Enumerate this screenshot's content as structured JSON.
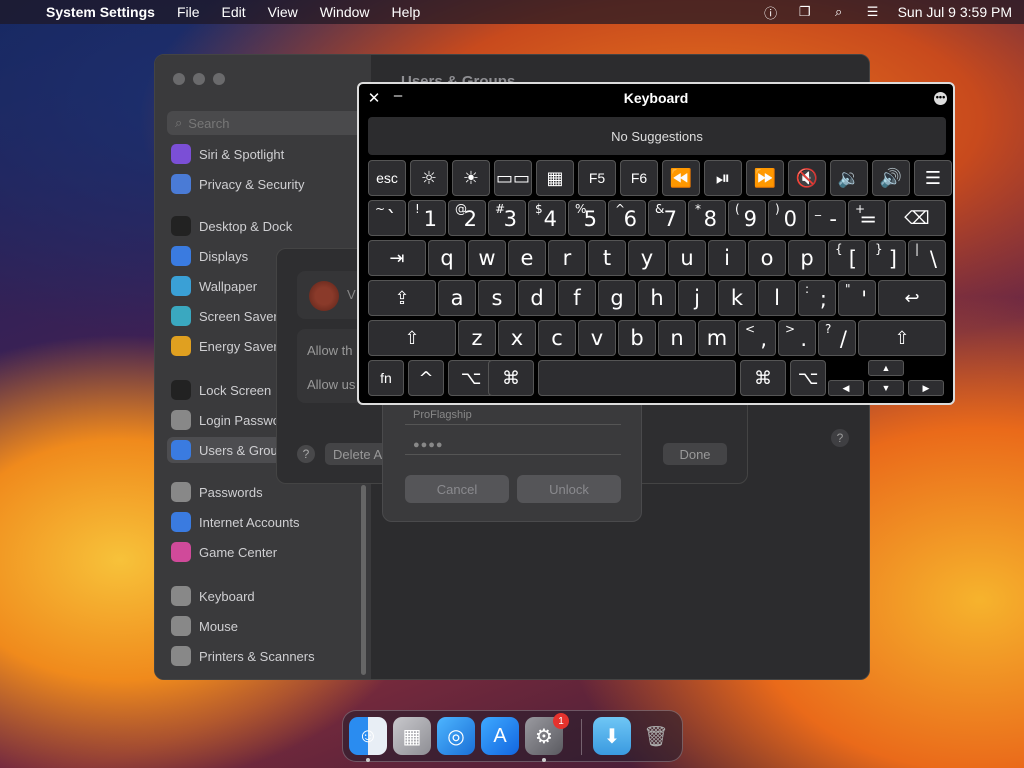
{
  "menubar": {
    "app_name": "System Settings",
    "menus": [
      "File",
      "Edit",
      "View",
      "Window",
      "Help"
    ],
    "clock": "Sun Jul 9  3:59 PM"
  },
  "settings": {
    "search_placeholder": "Search",
    "content_title": "Users & Groups",
    "sidebar": [
      {
        "label": "Siri & Spotlight",
        "icon": "siri-icon",
        "color": "#7b4fd6"
      },
      {
        "label": "Privacy & Security",
        "icon": "hand-icon",
        "color": "#4a7bd6"
      },
      {
        "label": "Desktop & Dock",
        "icon": "dock-icon",
        "color": "#222222"
      },
      {
        "label": "Displays",
        "icon": "sun-icon",
        "color": "#3a7be0"
      },
      {
        "label": "Wallpaper",
        "icon": "flower-icon",
        "color": "#3aa0d6"
      },
      {
        "label": "Screen Saver",
        "icon": "screen-icon",
        "color": "#3aa8c0"
      },
      {
        "label": "Energy Saver",
        "icon": "battery-icon",
        "color": "#e0a020"
      },
      {
        "label": "Lock Screen",
        "icon": "lock-icon",
        "color": "#222222"
      },
      {
        "label": "Login Password",
        "icon": "key-icon",
        "color": "#888888"
      },
      {
        "label": "Users & Groups",
        "icon": "users-icon",
        "color": "#3a7be0"
      },
      {
        "label": "Passwords",
        "icon": "password-key-icon",
        "color": "#888888"
      },
      {
        "label": "Internet Accounts",
        "icon": "at-icon",
        "color": "#3a7be0"
      },
      {
        "label": "Game Center",
        "icon": "game-center-icon",
        "color": "#d04a9a"
      },
      {
        "label": "Keyboard",
        "icon": "keyboard-icon",
        "color": "#888888"
      },
      {
        "label": "Mouse",
        "icon": "mouse-icon",
        "color": "#888888"
      },
      {
        "label": "Printers & Scanners",
        "icon": "printer-icon",
        "color": "#888888"
      }
    ]
  },
  "users_sheet": {
    "user_initial": "V",
    "allow_1": "Allow th",
    "allow_2": "Allow us",
    "delete_label": "Delete A",
    "done_label": "Done",
    "help": "?"
  },
  "unlock": {
    "user_value": "ProFlagship",
    "password_value": "●●●●",
    "cancel_label": "Cancel",
    "unlock_label": "Unlock"
  },
  "keyboard": {
    "title": "Keyboard",
    "suggestions": "No Suggestions",
    "rows": {
      "fn": [
        "esc",
        "☼",
        "☀",
        "▭▭",
        "▦",
        "F5",
        "F6",
        "⏪",
        "⏯",
        "⏩",
        "🔇",
        "🔉",
        "🔊",
        "☰"
      ],
      "numbers": [
        {
          "s": "~",
          "b": "`"
        },
        {
          "s": "!",
          "b": "1"
        },
        {
          "s": "@",
          "b": "2"
        },
        {
          "s": "#",
          "b": "3"
        },
        {
          "s": "$",
          "b": "4"
        },
        {
          "s": "%",
          "b": "5"
        },
        {
          "s": "^",
          "b": "6"
        },
        {
          "s": "&",
          "b": "7"
        },
        {
          "s": "*",
          "b": "8"
        },
        {
          "s": "(",
          "b": "9"
        },
        {
          "s": ")",
          "b": "0"
        },
        {
          "s": "_",
          "b": "-"
        },
        {
          "s": "+",
          "b": "="
        }
      ],
      "qwerty": [
        "q",
        "w",
        "e",
        "r",
        "t",
        "y",
        "u",
        "i",
        "o",
        "p"
      ],
      "qwerty_end": [
        {
          "s": "{",
          "b": "["
        },
        {
          "s": "}",
          "b": "]"
        },
        {
          "s": "|",
          "b": "\\"
        }
      ],
      "asdf": [
        "a",
        "s",
        "d",
        "f",
        "g",
        "h",
        "j",
        "k",
        "l"
      ],
      "asdf_end": [
        {
          "s": ":",
          "b": ";"
        },
        {
          "s": "\"",
          "b": "'"
        }
      ],
      "zxcv": [
        "z",
        "x",
        "c",
        "v",
        "b",
        "n",
        "m"
      ],
      "zxcv_end": [
        {
          "s": "<",
          "b": ","
        },
        {
          "s": ">",
          "b": "."
        },
        {
          "s": "?",
          "b": "/"
        }
      ]
    },
    "special": {
      "delete": "⌫",
      "tab": "⇥",
      "caps": "⇪",
      "return": "↩",
      "shift": "⇧",
      "fn": "fn",
      "control": "^",
      "option": "⌥",
      "command": "⌘",
      "up": "▲",
      "down": "▼",
      "left": "◀",
      "right": "▶"
    }
  },
  "dock": {
    "badge": "1"
  }
}
